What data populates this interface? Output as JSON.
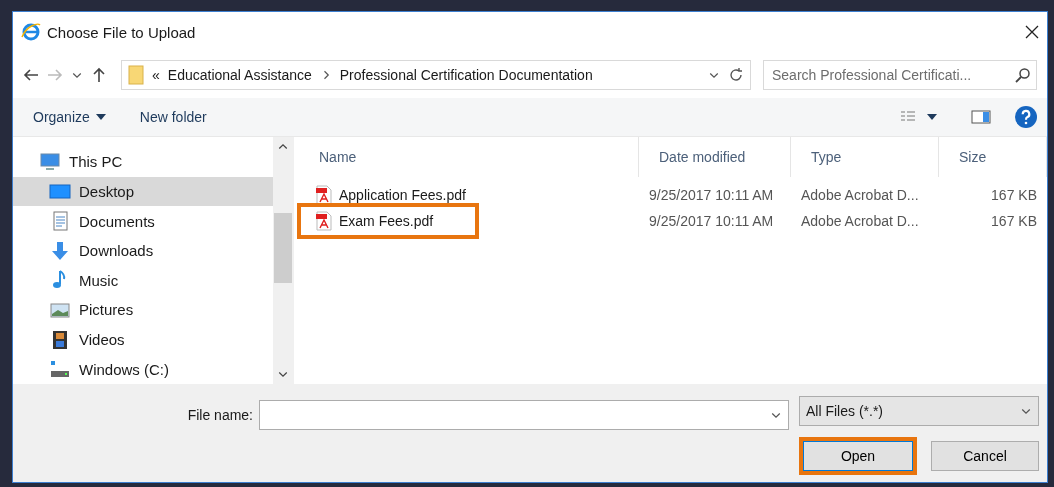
{
  "window": {
    "title": "Choose File to Upload"
  },
  "address": {
    "overflow": "«",
    "crumbs": [
      "Educational Assistance",
      "Professional Certification Documentation"
    ]
  },
  "search": {
    "placeholder": "Search Professional Certificati..."
  },
  "toolbar": {
    "organize": "Organize",
    "new_folder": "New folder"
  },
  "sidebar": {
    "items": [
      {
        "label": "This PC",
        "kind": "pc",
        "selected": false,
        "children": [
          {
            "label": "Desktop",
            "kind": "desktop",
            "selected": true
          },
          {
            "label": "Documents",
            "kind": "documents",
            "selected": false
          },
          {
            "label": "Downloads",
            "kind": "downloads",
            "selected": false
          },
          {
            "label": "Music",
            "kind": "music",
            "selected": false
          },
          {
            "label": "Pictures",
            "kind": "pictures",
            "selected": false
          },
          {
            "label": "Videos",
            "kind": "videos",
            "selected": false
          },
          {
            "label": "Windows (C:)",
            "kind": "drive",
            "selected": false
          }
        ]
      }
    ]
  },
  "columns": [
    "Name",
    "Date modified",
    "Type",
    "Size"
  ],
  "files": [
    {
      "name": "Application Fees.pdf",
      "date": "9/25/2017 10:11 AM",
      "type": "Adobe Acrobat D...",
      "size": "167 KB",
      "highlighted": false
    },
    {
      "name": "Exam Fees.pdf",
      "date": "9/25/2017 10:11 AM",
      "type": "Adobe Acrobat D...",
      "size": "167 KB",
      "highlighted": true
    }
  ],
  "footer": {
    "file_name_label": "File name:",
    "filter": "All Files (*.*)",
    "buttons": [
      {
        "label": "Open",
        "highlighted": true
      },
      {
        "label": "Cancel",
        "highlighted": false
      }
    ]
  }
}
